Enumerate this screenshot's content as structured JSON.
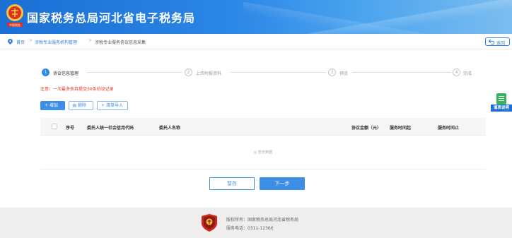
{
  "header": {
    "title": "国家税务总局河北省电子税务局",
    "emblem_text": "中国税务"
  },
  "breadcrumb": {
    "items": [
      "首页",
      "涉税专业服务机构管理",
      "涉税专业服务协议信息采集"
    ],
    "separator": ">",
    "back_label": "返回"
  },
  "steps": [
    {
      "num": "1",
      "label": "协议信息管理",
      "active": true
    },
    {
      "num": "2",
      "label": "上传附报资料",
      "active": false
    },
    {
      "num": "3",
      "label": "预览",
      "active": false
    },
    {
      "num": "4",
      "label": "完成",
      "active": false
    }
  ],
  "notice": "注意：一次最多支持提交30条协议记录",
  "toolbar": {
    "add_icon": "+",
    "add_label": "增加",
    "delete_icon": "▤",
    "delete_label": "删除",
    "import_icon": "+",
    "import_label": "清单导入"
  },
  "table": {
    "columns": [
      "序号",
      "委托人统一社会信用代码",
      "委托人名称",
      "协议金额（元）",
      "服务时间起",
      "服务时间止"
    ],
    "empty_text": "◎ 暂无数据"
  },
  "actions": {
    "save_label": "暂存",
    "next_label": "下一步"
  },
  "float_widget": {
    "label": "填表说明"
  },
  "footer": {
    "copyright": "版权所有：国家税务总局河北省税务局",
    "phone": "服务电话：0311-12366"
  },
  "colors": {
    "primary": "#3d8fe6",
    "header_blue": "#1a6fd4",
    "notice_red": "#e2311a",
    "widget_green": "#35b35a"
  }
}
